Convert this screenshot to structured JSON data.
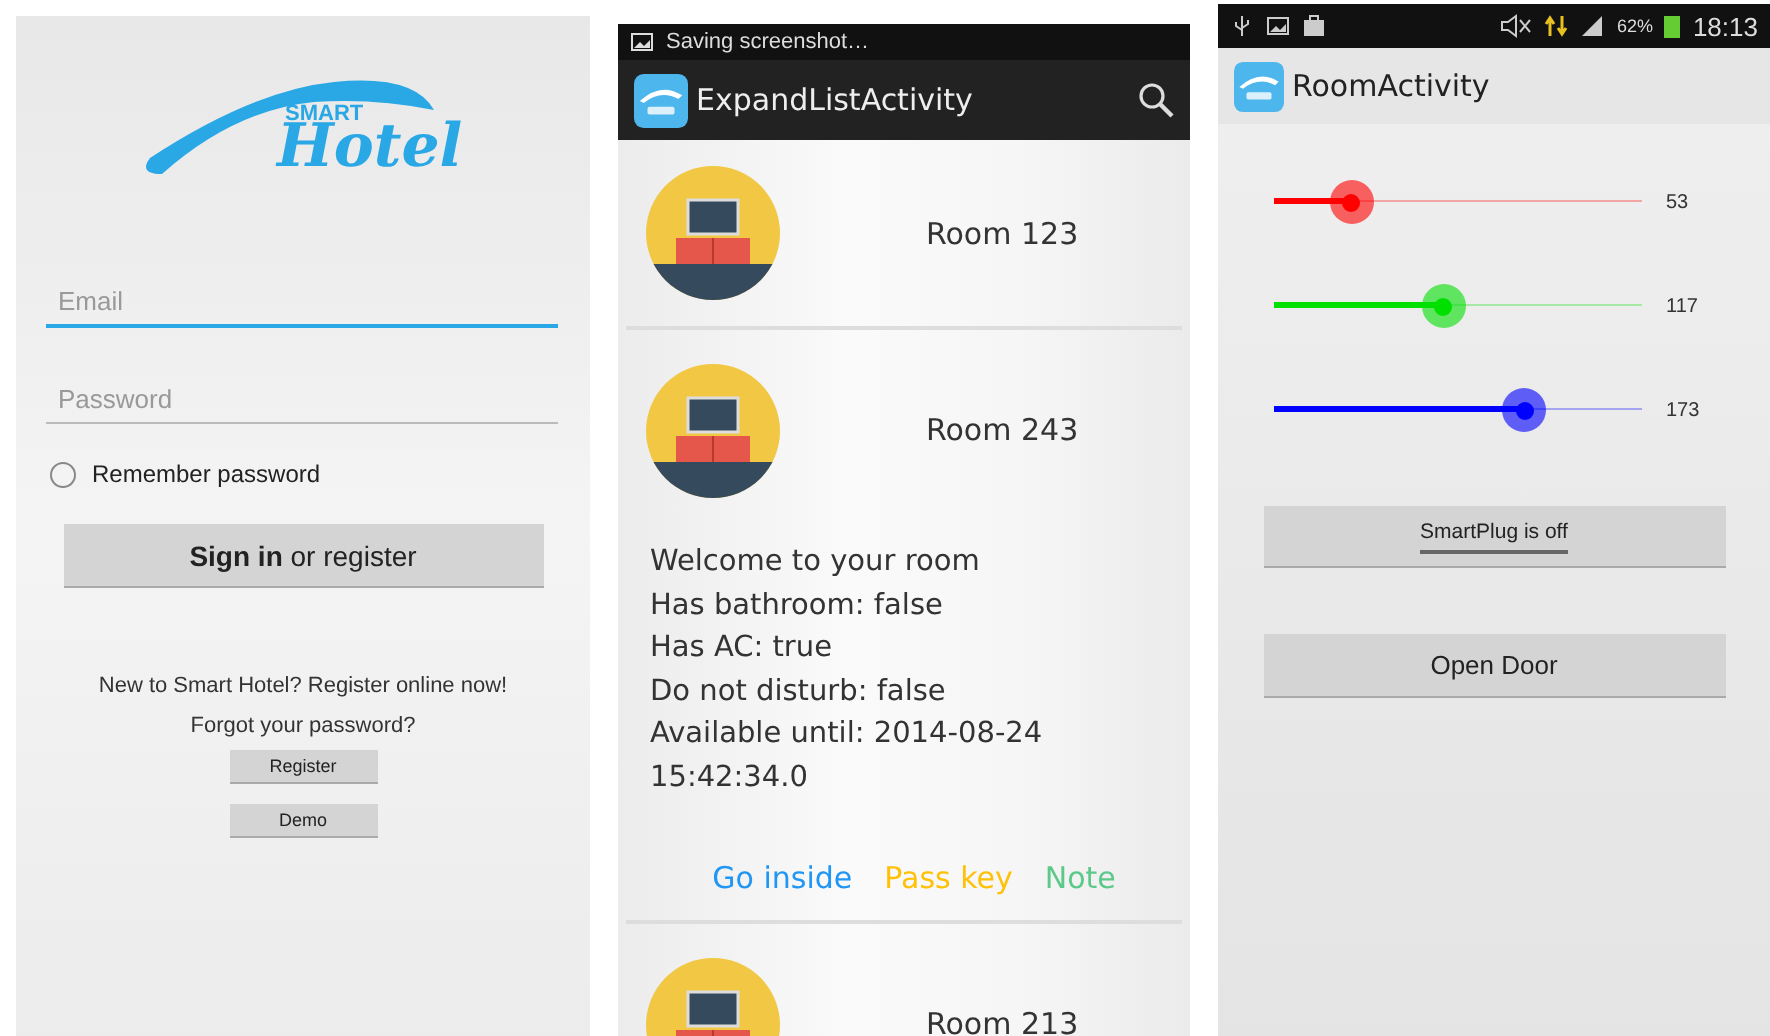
{
  "login": {
    "logo_small": "SMART",
    "logo": "Hotel",
    "email": {
      "placeholder": "Email",
      "focused": true
    },
    "password": {
      "placeholder": "Password",
      "focused": false
    },
    "remember": {
      "label": "Remember password",
      "checked": false
    },
    "sign_in_button": "**Sign in** or register",
    "register_prompt": "New to Smart Hotel? Register online now!",
    "forgot": "Forgot your password?",
    "buttons": [
      "Register",
      "Demo"
    ]
  },
  "list_screen": {
    "status_text": "Saving screenshot…",
    "title": "ExpandListActivity",
    "rooms": [
      {
        "name": "Room 123",
        "expanded": false
      },
      {
        "name": "Room 243",
        "expanded": true,
        "details": [
          "Welcome to your room",
          "Has bathroom: false",
          "Has AC: true",
          "Do not disturb: false",
          "Available until: 2014-08-24 15:42:34.0"
        ],
        "actions": [
          {
            "label": "Go inside",
            "color": "#2196f3"
          },
          {
            "label": "Pass key",
            "color": "#ffc107"
          },
          {
            "label": "Note",
            "color": "#5cc98a"
          }
        ]
      },
      {
        "name": "Room 213",
        "expanded": false
      }
    ]
  },
  "room_screen": {
    "battery": "62%",
    "time": "18:13",
    "title": "RoomActivity",
    "sliders": [
      {
        "color": "#ff0000",
        "level": 0.21,
        "reading": "53"
      },
      {
        "color": "#00e000",
        "level": 0.46,
        "reading": "117"
      },
      {
        "color": "#0000ff",
        "level": 0.68,
        "reading": "173"
      }
    ],
    "smartplug": {
      "label": "SmartPlug is off",
      "on": false
    },
    "open_door": "Open Door"
  }
}
